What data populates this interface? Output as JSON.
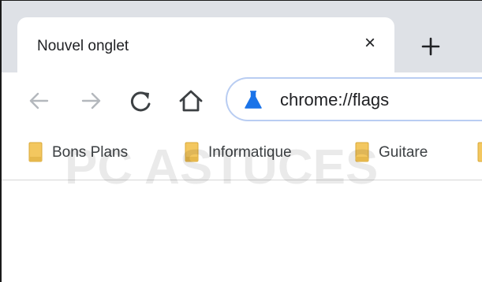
{
  "tab": {
    "title": "Nouvel onglet",
    "close_glyph": "×"
  },
  "new_tab": {
    "icon": "plus-icon"
  },
  "toolbar": {
    "back_icon": "arrow-left-icon",
    "forward_icon": "arrow-right-icon",
    "reload_icon": "reload-icon",
    "home_icon": "home-icon"
  },
  "omnibox": {
    "url": "chrome://flags",
    "icon": "flask-icon"
  },
  "bookmarks": [
    {
      "label": "Bons Plans",
      "icon": "folder-icon"
    },
    {
      "label": "Informatique",
      "icon": "folder-icon"
    },
    {
      "label": "Guitare",
      "icon": "folder-icon"
    }
  ],
  "watermark": {
    "text": "PC ASTUCES"
  },
  "colors": {
    "tabstrip": "#dee1e6",
    "omnibox_border": "#b9cdf2",
    "flask": "#1a73e8",
    "folder": "#f3c75f",
    "icon_disabled": "#9aa0a6",
    "icon_active": "#3c4043"
  }
}
